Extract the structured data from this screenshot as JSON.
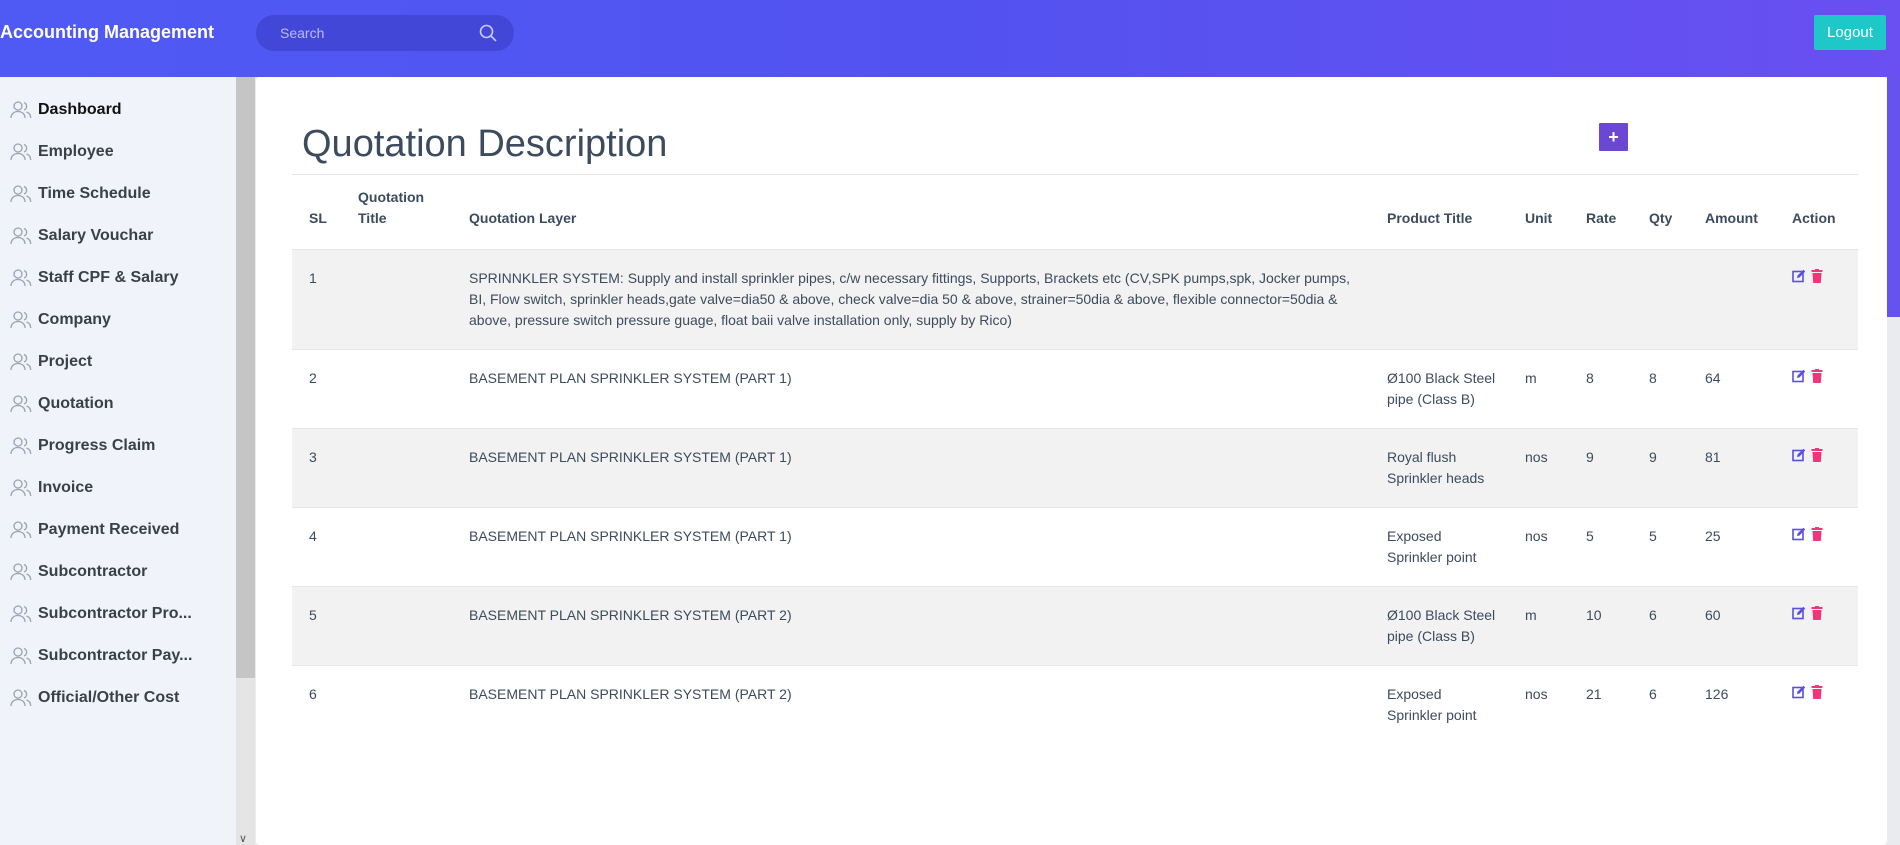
{
  "app": {
    "title": "Accounting Management"
  },
  "search": {
    "placeholder": "Search"
  },
  "header": {
    "logout_label": "Logout"
  },
  "sidebar": {
    "items": [
      {
        "label": "Dashboard"
      },
      {
        "label": "Employee"
      },
      {
        "label": "Time Schedule"
      },
      {
        "label": "Salary Vouchar"
      },
      {
        "label": "Staff CPF & Salary"
      },
      {
        "label": "Company"
      },
      {
        "label": "Project"
      },
      {
        "label": "Quotation"
      },
      {
        "label": "Progress Claim"
      },
      {
        "label": "Invoice"
      },
      {
        "label": "Payment Received"
      },
      {
        "label": "Subcontractor"
      },
      {
        "label": "Subcontractor Pro..."
      },
      {
        "label": "Subcontractor Pay..."
      },
      {
        "label": "Official/Other Cost"
      }
    ]
  },
  "page": {
    "title": "Quotation Description",
    "add_label": "+"
  },
  "table": {
    "columns": [
      "SL",
      "Quotation Title",
      "Quotation Layer",
      "Product Title",
      "Unit",
      "Rate",
      "Qty",
      "Amount",
      "Action"
    ],
    "rows": [
      {
        "sl": "1",
        "quotation_title": "",
        "layer": "SPRINNKLER SYSTEM: Supply and install sprinkler pipes, c/w necessary fittings, Supports, Brackets etc (CV,SPK pumps,spk, Jocker pumps, BI, Flow switch, sprinkler heads,gate valve=dia50 & above, check valve=dia 50 & above, strainer=50dia & above, flexible connector=50dia & above, pressure switch pressure guage, float baii valve installation only, supply by Rico)",
        "product": "",
        "unit": "",
        "rate": "",
        "qty": "",
        "amount": ""
      },
      {
        "sl": "2",
        "quotation_title": "",
        "layer": "BASEMENT PLAN SPRINKLER SYSTEM (PART 1)",
        "product": "Ø100 Black Steel pipe (Class B)",
        "unit": "m",
        "rate": "8",
        "qty": "8",
        "amount": "64"
      },
      {
        "sl": "3",
        "quotation_title": "",
        "layer": "BASEMENT PLAN SPRINKLER SYSTEM (PART 1)",
        "product": "Royal flush Sprinkler heads",
        "unit": "nos",
        "rate": "9",
        "qty": "9",
        "amount": "81"
      },
      {
        "sl": "4",
        "quotation_title": "",
        "layer": "BASEMENT PLAN SPRINKLER SYSTEM (PART 1)",
        "product": "Exposed Sprinkler point",
        "unit": "nos",
        "rate": "5",
        "qty": "5",
        "amount": "25"
      },
      {
        "sl": "5",
        "quotation_title": "",
        "layer": "BASEMENT PLAN SPRINKLER SYSTEM (PART 2)",
        "product": "Ø100 Black Steel pipe (Class B)",
        "unit": "m",
        "rate": "10",
        "qty": "6",
        "amount": "60"
      },
      {
        "sl": "6",
        "quotation_title": "",
        "layer": "BASEMENT PLAN SPRINKLER SYSTEM (PART 2)",
        "product": "Exposed Sprinkler point",
        "unit": "nos",
        "rate": "21",
        "qty": "6",
        "amount": "126"
      }
    ]
  },
  "icons": {
    "nav": "users-icon",
    "search": "search-icon",
    "edit": "edit-icon",
    "delete": "trash-icon"
  },
  "colors": {
    "accent": "#5252f0",
    "logout": "#1ec8c8",
    "add_button": "#6c47d3",
    "edit": "#5a4fe0",
    "delete": "#f0357a"
  }
}
